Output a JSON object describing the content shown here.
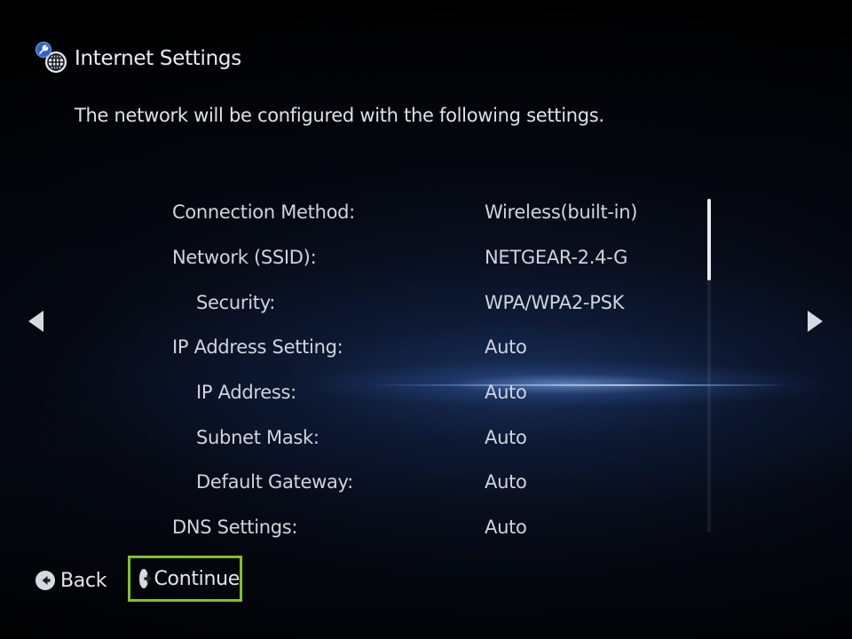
{
  "header": {
    "title": "Internet Settings",
    "icon": "globe-icon",
    "badge_icon": "wrench-icon"
  },
  "description": "The network will be configured with the following settings.",
  "settings": [
    {
      "label": "Connection Method:",
      "value": "Wireless(built-in)",
      "indent": false
    },
    {
      "label": "Network (SSID):",
      "value": "NETGEAR-2.4-G",
      "indent": false
    },
    {
      "label": "Security:",
      "value": "WPA/WPA2-PSK",
      "indent": true
    },
    {
      "label": "IP Address Setting:",
      "value": "Auto",
      "indent": false
    },
    {
      "label": "IP Address:",
      "value": "Auto",
      "indent": true
    },
    {
      "label": "Subnet Mask:",
      "value": "Auto",
      "indent": true
    },
    {
      "label": "Default Gateway:",
      "value": "Auto",
      "indent": true
    },
    {
      "label": "DNS Settings:",
      "value": "Auto",
      "indent": false
    }
  ],
  "footer": {
    "back_label": "Back",
    "continue_label": "Continue"
  },
  "colors": {
    "focus_border": "#7cc427",
    "badge_blue": "#2d63c9",
    "text": "#cfd5dc"
  }
}
